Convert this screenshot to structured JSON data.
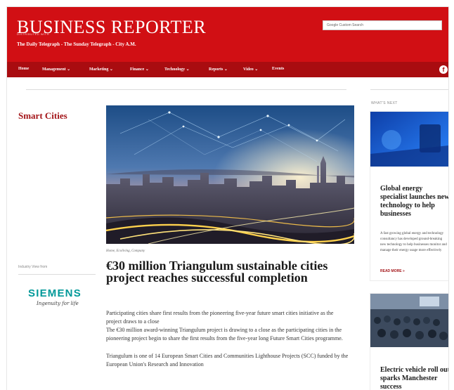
{
  "header": {
    "brand": "BUSINESS REPORTER",
    "brand_small": "DISTRIBUTED WITH",
    "tagline": "The Daily Telegraph - The Sunday Telegraph - City A.M.",
    "search_placeholder": "Google Custom Search"
  },
  "nav": {
    "items": [
      {
        "label": "Home"
      },
      {
        "label": "Management ⌄"
      },
      {
        "label": "Marketing ⌄"
      },
      {
        "label": "Finance ⌄"
      },
      {
        "label": "Technology ⌄"
      },
      {
        "label": "Reports ⌄"
      },
      {
        "label": "Video ⌄"
      },
      {
        "label": "Events"
      }
    ],
    "social_icon": "facebook-icon",
    "social_glyph": "f"
  },
  "section": {
    "title": "Smart Cities"
  },
  "article": {
    "breadcrumb": "Home, Ecoliving, Company",
    "headline": "€30 million Triangulum sustainable cities project reaches successful completion",
    "paragraphs": [
      "Participating cities share first results from the pioneering five-year future smart cities initiative as the project draws to a close",
      "The €30 million award-winning Triangulum project is drawing to a close as the participating cities in the pioneering project begin to share the first results from the five-year long Future Smart Cities programme.",
      "Triangulum is one of 14 European Smart Cities and Communities Lighthouse Projects (SCC) funded by the European Union's Research and Innovation"
    ]
  },
  "sidebar_left": {
    "label": "Industry View from",
    "sponsor_name": "SIEMENS",
    "sponsor_tagline": "Ingenuity for life"
  },
  "sidebar_right": {
    "heading": "WHAT'S NEXT",
    "cards": [
      {
        "title": "Global energy specialist launches new technology to help businesses",
        "blurb": "A fast growing global energy and technology consultancy has developed ground-breaking new technology to help businesses monitor and manage their energy usage more effectively",
        "read_more": "READ MORE »"
      },
      {
        "title": "Electric vehicle roll out sparks Manchester success"
      }
    ]
  },
  "colors": {
    "brand_red": "#d10f14",
    "nav_red": "#a90c10",
    "section_red": "#a31418",
    "siemens_teal": "#009999"
  }
}
